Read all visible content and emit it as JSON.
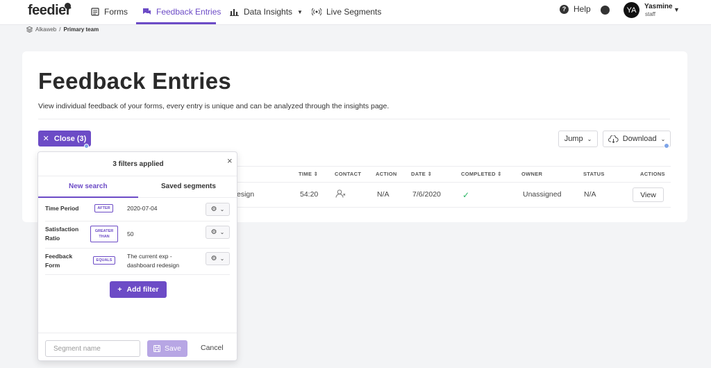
{
  "nav": {
    "logo": "feedier",
    "items": [
      {
        "label": "Forms",
        "icon": "list-icon"
      },
      {
        "label": "Feedback Entries",
        "icon": "chat-icon"
      },
      {
        "label": "Data Insights",
        "icon": "bar-chart-icon"
      },
      {
        "label": "Live Segments",
        "icon": "broadcast-icon"
      }
    ],
    "help": "Help",
    "user": {
      "initials": "YA",
      "name": "Yasmine",
      "role": "staff"
    }
  },
  "breadcrumb": {
    "org": "Alkaweb",
    "team": "Primary team"
  },
  "page": {
    "title": "Feedback Entries",
    "description": "View individual feedback of your forms, every entry is unique and can be analyzed through the insights page."
  },
  "toolbar": {
    "close_label": "Close (3)",
    "jump_label": "Jump",
    "download_label": "Download"
  },
  "table": {
    "headers": [
      "TIME",
      "CONTACT",
      "ACTION",
      "DATE",
      "COMPLETED",
      "OWNER",
      "STATUS",
      "ACTIONS"
    ],
    "rows": [
      {
        "form": "esign",
        "time": "54:20",
        "action": "N/A",
        "date": "7/6/2020",
        "owner": "Unassigned",
        "status": "N/A",
        "view_label": "View"
      }
    ]
  },
  "filter_panel": {
    "title": "3 filters applied",
    "tabs": [
      "New search",
      "Saved segments"
    ],
    "filters": [
      {
        "label": "Time Period",
        "operator": "AFTER",
        "value": "2020-07-04"
      },
      {
        "label": "Satisfaction Ratio",
        "operator": "GREATER THAN",
        "value": "50"
      },
      {
        "label": "Feedback Form",
        "operator": "EQUALS",
        "value": "The current exp - dashboard redesign"
      }
    ],
    "add_filter_label": "Add filter",
    "segment_placeholder": "Segment name",
    "save_label": "Save",
    "cancel_label": "Cancel"
  },
  "colors": {
    "accent": "#6c4bc6",
    "success": "#28b463",
    "save_disabled": "#b7a6e4"
  }
}
